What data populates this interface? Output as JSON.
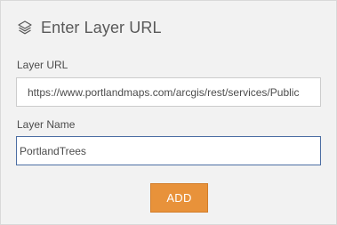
{
  "panel": {
    "title": "Enter Layer URL",
    "icon": "layers-icon"
  },
  "layer_url": {
    "label": "Layer URL",
    "value": "https://www.portlandmaps.com/arcgis/rest/services/Public"
  },
  "layer_name": {
    "label": "Layer Name",
    "value": "PortlandTrees"
  },
  "actions": {
    "add_label": "ADD",
    "add_color": "#e8923a"
  }
}
